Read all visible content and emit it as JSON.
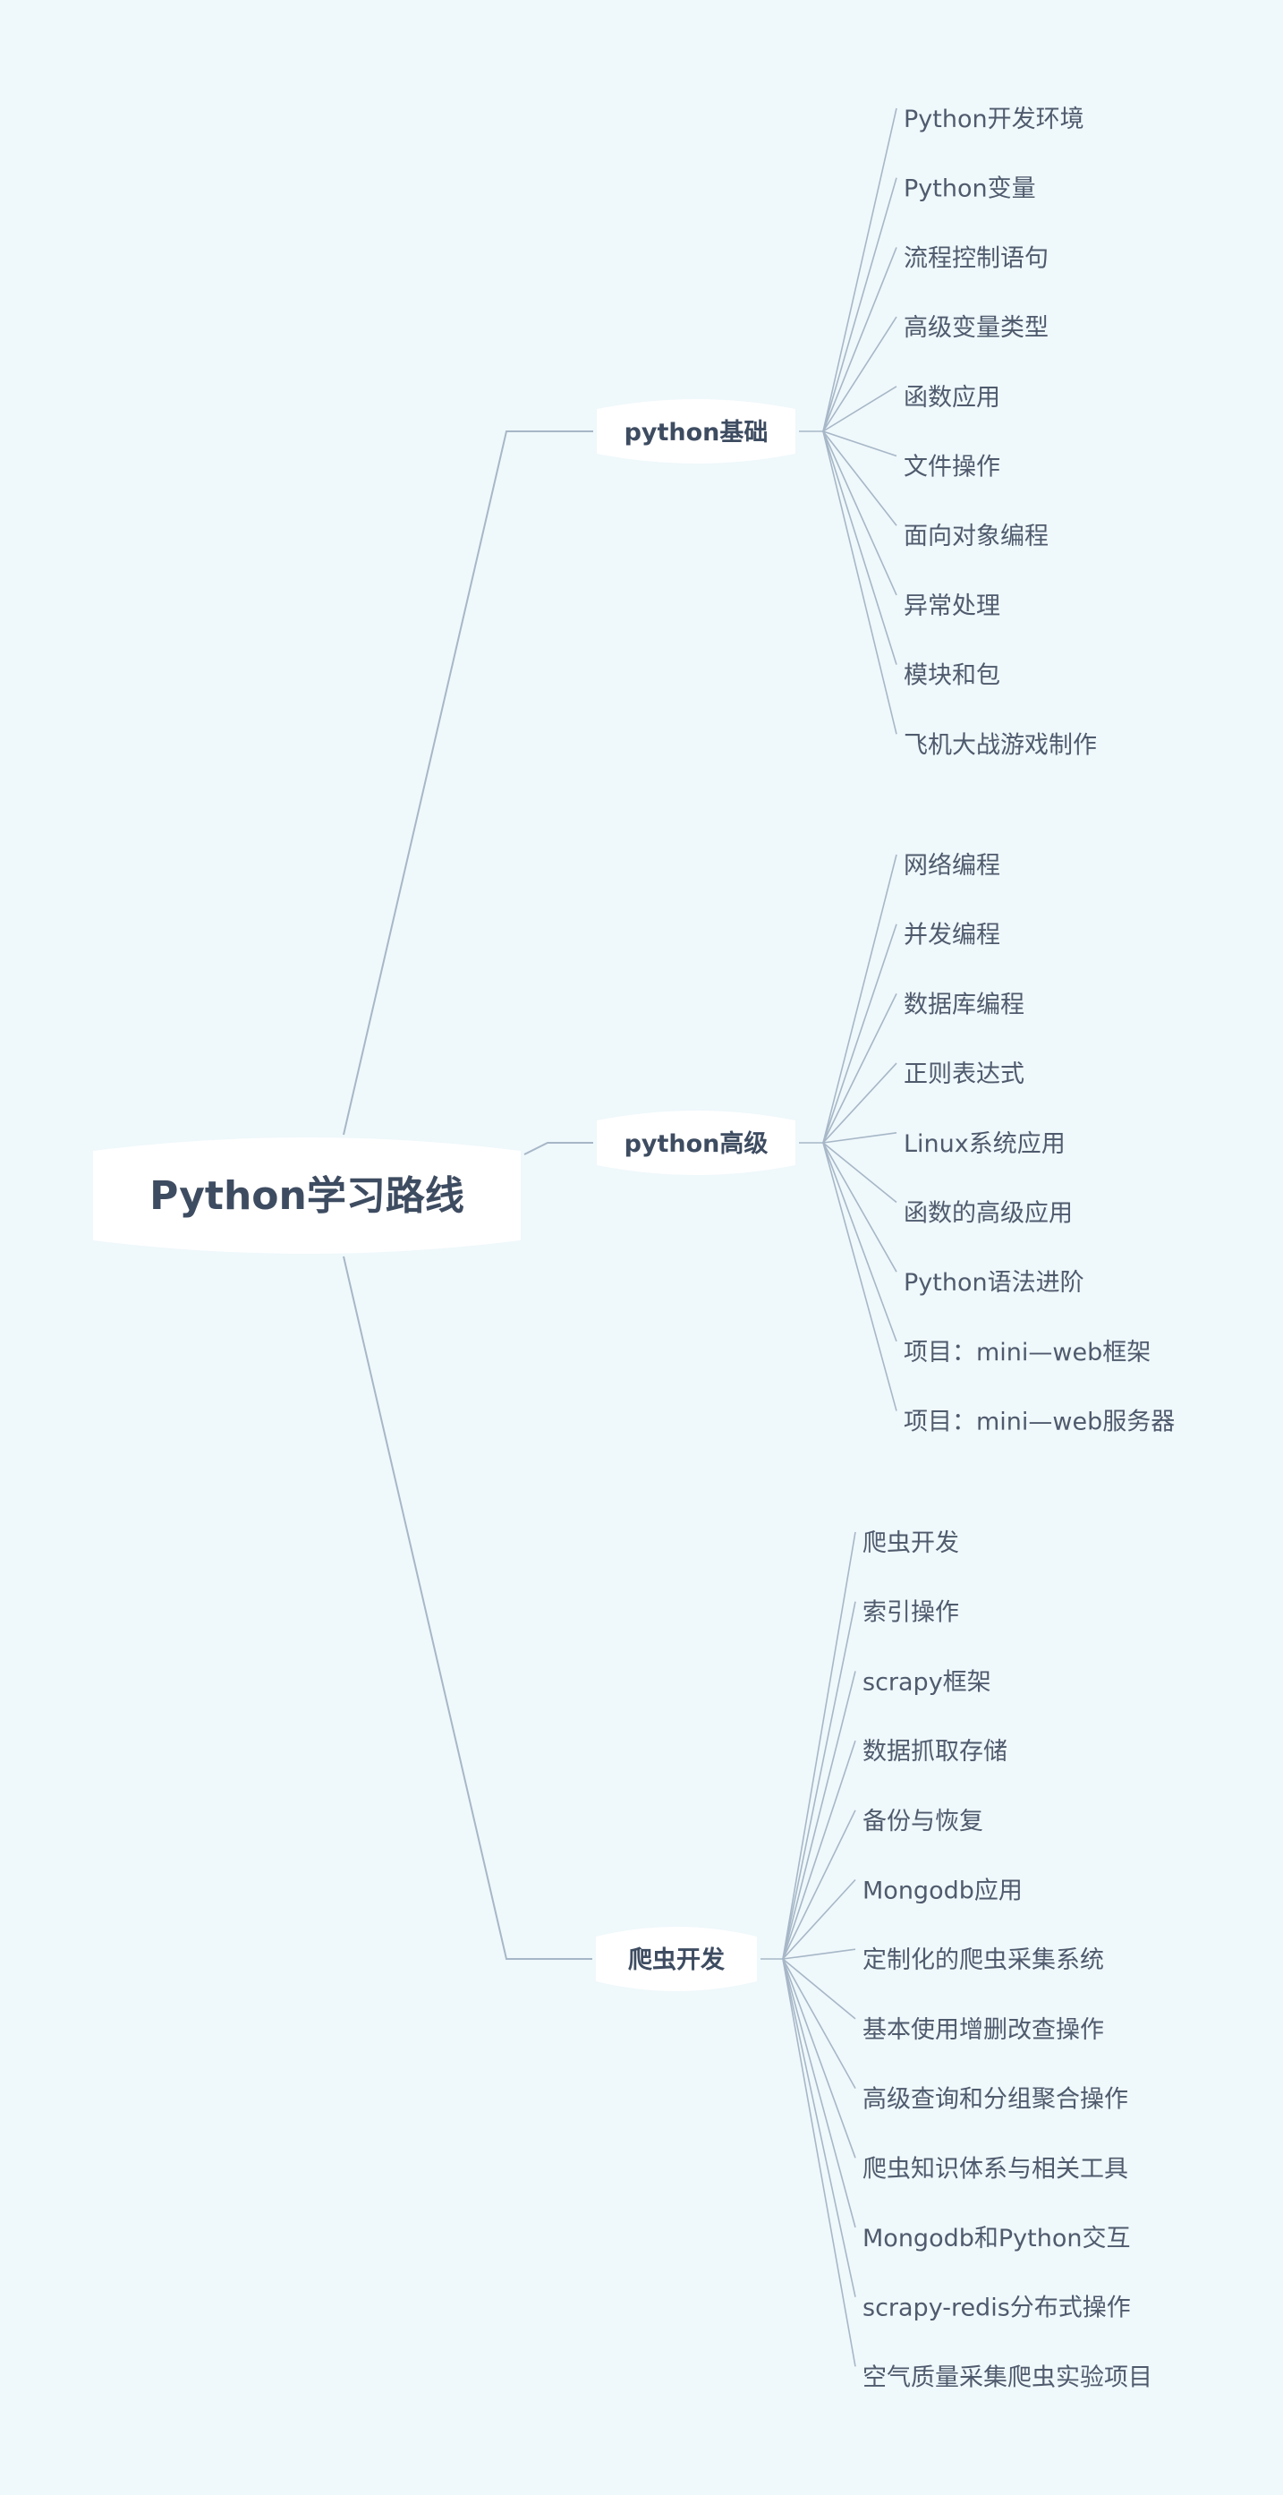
{
  "root": {
    "label": "Python学习路线"
  },
  "branches": [
    {
      "label": "python基础",
      "items": [
        "Python开发环境",
        "Python变量",
        "流程控制语句",
        "高级变量类型",
        "函数应用",
        "文件操作",
        "面向对象编程",
        "异常处理",
        "模块和包",
        "飞机大战游戏制作"
      ]
    },
    {
      "label": "python高级",
      "items": [
        "网络编程",
        "并发编程",
        "数据库编程",
        "正则表达式",
        "Linux系统应用",
        "函数的高级应用",
        "Python语法进阶",
        "项目：mini—web框架",
        "项目：mini—web服务器"
      ]
    },
    {
      "label": "爬虫开发",
      "items": [
        "爬虫开发",
        "索引操作",
        "scrapy框架",
        "数据抓取存储",
        "备份与恢复",
        "Mongodb应用",
        "定制化的爬虫采集系统",
        "基本使用增删改查操作",
        "高级查询和分组聚合操作",
        "爬虫知识体系与相关工具",
        "Mongodb和Python交互",
        "scrapy-redis分布式操作",
        "空气质量采集爬虫实验项目"
      ]
    }
  ],
  "colors": {
    "background": "#eff8fb",
    "node": "#ffffff",
    "line": "#a7b7c7",
    "branch_text": "#3e4c61",
    "leaf_text": "#4f5b6d"
  }
}
